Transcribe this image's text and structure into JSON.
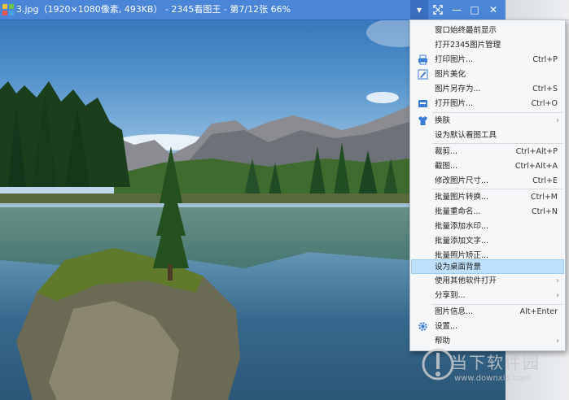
{
  "window": {
    "title": "3.jpg（1920×1080像素, 493KB） - 2345看图王 - 第7/12张 66%",
    "buttons": {
      "dropdown": "▾",
      "fullscreen": "fullscreen-icon",
      "minimize": "—",
      "maximize": "□",
      "close": "✕"
    },
    "colors": {
      "titlebar": "#4a85d8",
      "menu_bg": "#f6f7f9",
      "highlight": "#bfe0fb"
    }
  },
  "menu": {
    "items": [
      {
        "label": "窗口始终最前显示",
        "shortcut": "",
        "submenu": false,
        "icon": ""
      },
      {
        "label": "打开2345图片管理",
        "shortcut": "",
        "submenu": false,
        "icon": ""
      },
      {
        "label": "打印图片...",
        "shortcut": "Ctrl+P",
        "submenu": false,
        "icon": "printer-icon"
      },
      {
        "label": "图片美化",
        "shortcut": "",
        "submenu": false,
        "icon": "edit-icon"
      },
      {
        "label": "图片另存为...",
        "shortcut": "Ctrl+S",
        "submenu": false,
        "icon": ""
      },
      {
        "label": "打开图片...",
        "shortcut": "Ctrl+O",
        "submenu": false,
        "icon": "open-icon"
      },
      {
        "label": "换肤",
        "shortcut": "",
        "submenu": true,
        "icon": "shirt-icon"
      },
      {
        "label": "设为默认看图工具",
        "shortcut": "",
        "submenu": false,
        "icon": ""
      },
      {
        "label": "裁剪...",
        "shortcut": "Ctrl+Alt+P",
        "submenu": false,
        "icon": ""
      },
      {
        "label": "截图...",
        "shortcut": "Ctrl+Alt+A",
        "submenu": false,
        "icon": ""
      },
      {
        "label": "修改图片尺寸...",
        "shortcut": "Ctrl+E",
        "submenu": false,
        "icon": ""
      },
      {
        "label": "批量图片转换...",
        "shortcut": "Ctrl+M",
        "submenu": false,
        "icon": ""
      },
      {
        "label": "批量重命名...",
        "shortcut": "Ctrl+N",
        "submenu": false,
        "icon": ""
      },
      {
        "label": "批量添加水印...",
        "shortcut": "",
        "submenu": false,
        "icon": ""
      },
      {
        "label": "批量添加文字...",
        "shortcut": "",
        "submenu": false,
        "icon": ""
      },
      {
        "label": "批量照片矫正...",
        "shortcut": "",
        "submenu": false,
        "icon": ""
      },
      {
        "label": "设为桌面背景",
        "shortcut": "",
        "submenu": false,
        "icon": "",
        "highlighted": true
      },
      {
        "label": "使用其他软件打开",
        "shortcut": "",
        "submenu": true,
        "icon": ""
      },
      {
        "label": "分享到...",
        "shortcut": "",
        "submenu": true,
        "icon": ""
      },
      {
        "label": "图片信息...",
        "shortcut": "Alt+Enter",
        "submenu": false,
        "icon": ""
      },
      {
        "label": "设置...",
        "shortcut": "",
        "submenu": false,
        "icon": "gear-icon"
      },
      {
        "label": "帮助",
        "shortcut": "",
        "submenu": true,
        "icon": ""
      }
    ]
  },
  "watermark": {
    "text": "当下软件园",
    "url": "www.downxia.com"
  }
}
